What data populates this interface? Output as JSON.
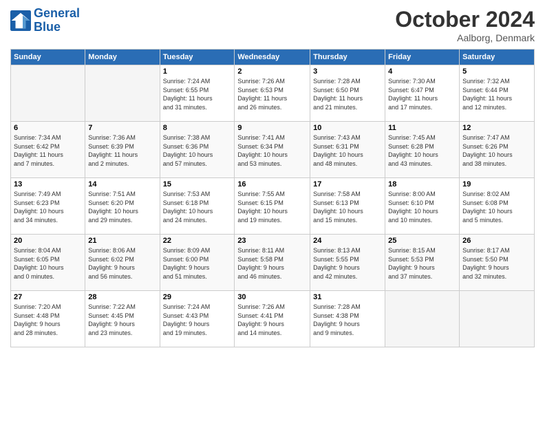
{
  "logo": {
    "line1": "General",
    "line2": "Blue"
  },
  "header": {
    "month": "October 2024",
    "location": "Aalborg, Denmark"
  },
  "weekdays": [
    "Sunday",
    "Monday",
    "Tuesday",
    "Wednesday",
    "Thursday",
    "Friday",
    "Saturday"
  ],
  "weeks": [
    [
      {
        "num": "",
        "detail": ""
      },
      {
        "num": "",
        "detail": ""
      },
      {
        "num": "1",
        "detail": "Sunrise: 7:24 AM\nSunset: 6:55 PM\nDaylight: 11 hours\nand 31 minutes."
      },
      {
        "num": "2",
        "detail": "Sunrise: 7:26 AM\nSunset: 6:53 PM\nDaylight: 11 hours\nand 26 minutes."
      },
      {
        "num": "3",
        "detail": "Sunrise: 7:28 AM\nSunset: 6:50 PM\nDaylight: 11 hours\nand 21 minutes."
      },
      {
        "num": "4",
        "detail": "Sunrise: 7:30 AM\nSunset: 6:47 PM\nDaylight: 11 hours\nand 17 minutes."
      },
      {
        "num": "5",
        "detail": "Sunrise: 7:32 AM\nSunset: 6:44 PM\nDaylight: 11 hours\nand 12 minutes."
      }
    ],
    [
      {
        "num": "6",
        "detail": "Sunrise: 7:34 AM\nSunset: 6:42 PM\nDaylight: 11 hours\nand 7 minutes."
      },
      {
        "num": "7",
        "detail": "Sunrise: 7:36 AM\nSunset: 6:39 PM\nDaylight: 11 hours\nand 2 minutes."
      },
      {
        "num": "8",
        "detail": "Sunrise: 7:38 AM\nSunset: 6:36 PM\nDaylight: 10 hours\nand 57 minutes."
      },
      {
        "num": "9",
        "detail": "Sunrise: 7:41 AM\nSunset: 6:34 PM\nDaylight: 10 hours\nand 53 minutes."
      },
      {
        "num": "10",
        "detail": "Sunrise: 7:43 AM\nSunset: 6:31 PM\nDaylight: 10 hours\nand 48 minutes."
      },
      {
        "num": "11",
        "detail": "Sunrise: 7:45 AM\nSunset: 6:28 PM\nDaylight: 10 hours\nand 43 minutes."
      },
      {
        "num": "12",
        "detail": "Sunrise: 7:47 AM\nSunset: 6:26 PM\nDaylight: 10 hours\nand 38 minutes."
      }
    ],
    [
      {
        "num": "13",
        "detail": "Sunrise: 7:49 AM\nSunset: 6:23 PM\nDaylight: 10 hours\nand 34 minutes."
      },
      {
        "num": "14",
        "detail": "Sunrise: 7:51 AM\nSunset: 6:20 PM\nDaylight: 10 hours\nand 29 minutes."
      },
      {
        "num": "15",
        "detail": "Sunrise: 7:53 AM\nSunset: 6:18 PM\nDaylight: 10 hours\nand 24 minutes."
      },
      {
        "num": "16",
        "detail": "Sunrise: 7:55 AM\nSunset: 6:15 PM\nDaylight: 10 hours\nand 19 minutes."
      },
      {
        "num": "17",
        "detail": "Sunrise: 7:58 AM\nSunset: 6:13 PM\nDaylight: 10 hours\nand 15 minutes."
      },
      {
        "num": "18",
        "detail": "Sunrise: 8:00 AM\nSunset: 6:10 PM\nDaylight: 10 hours\nand 10 minutes."
      },
      {
        "num": "19",
        "detail": "Sunrise: 8:02 AM\nSunset: 6:08 PM\nDaylight: 10 hours\nand 5 minutes."
      }
    ],
    [
      {
        "num": "20",
        "detail": "Sunrise: 8:04 AM\nSunset: 6:05 PM\nDaylight: 10 hours\nand 0 minutes."
      },
      {
        "num": "21",
        "detail": "Sunrise: 8:06 AM\nSunset: 6:02 PM\nDaylight: 9 hours\nand 56 minutes."
      },
      {
        "num": "22",
        "detail": "Sunrise: 8:09 AM\nSunset: 6:00 PM\nDaylight: 9 hours\nand 51 minutes."
      },
      {
        "num": "23",
        "detail": "Sunrise: 8:11 AM\nSunset: 5:58 PM\nDaylight: 9 hours\nand 46 minutes."
      },
      {
        "num": "24",
        "detail": "Sunrise: 8:13 AM\nSunset: 5:55 PM\nDaylight: 9 hours\nand 42 minutes."
      },
      {
        "num": "25",
        "detail": "Sunrise: 8:15 AM\nSunset: 5:53 PM\nDaylight: 9 hours\nand 37 minutes."
      },
      {
        "num": "26",
        "detail": "Sunrise: 8:17 AM\nSunset: 5:50 PM\nDaylight: 9 hours\nand 32 minutes."
      }
    ],
    [
      {
        "num": "27",
        "detail": "Sunrise: 7:20 AM\nSunset: 4:48 PM\nDaylight: 9 hours\nand 28 minutes."
      },
      {
        "num": "28",
        "detail": "Sunrise: 7:22 AM\nSunset: 4:45 PM\nDaylight: 9 hours\nand 23 minutes."
      },
      {
        "num": "29",
        "detail": "Sunrise: 7:24 AM\nSunset: 4:43 PM\nDaylight: 9 hours\nand 19 minutes."
      },
      {
        "num": "30",
        "detail": "Sunrise: 7:26 AM\nSunset: 4:41 PM\nDaylight: 9 hours\nand 14 minutes."
      },
      {
        "num": "31",
        "detail": "Sunrise: 7:28 AM\nSunset: 4:38 PM\nDaylight: 9 hours\nand 9 minutes."
      },
      {
        "num": "",
        "detail": ""
      },
      {
        "num": "",
        "detail": ""
      }
    ]
  ]
}
